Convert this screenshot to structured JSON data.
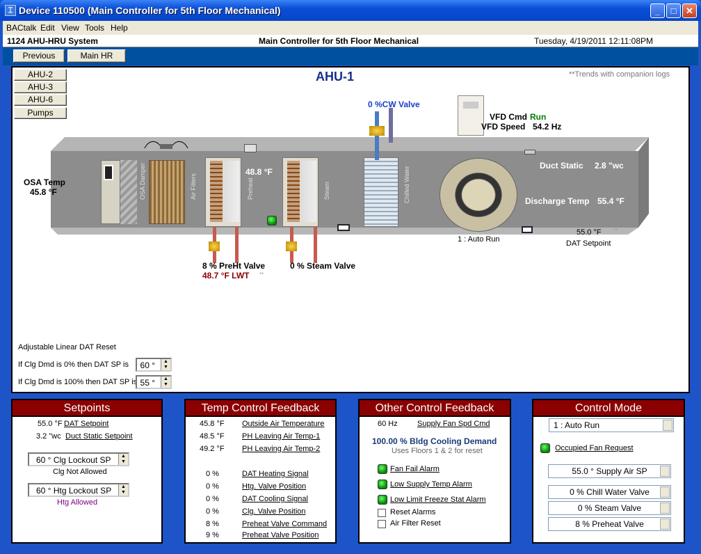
{
  "window": {
    "title": "Device 110500 (Main Controller for 5th Floor Mechanical)",
    "icon": "bactalk-icon"
  },
  "menu": [
    "BACtalk",
    "Edit",
    "View",
    "Tools",
    "Help"
  ],
  "header": {
    "system": "1124 AHU-HRU System",
    "controller": "Main Controller for 5th Floor Mechanical",
    "datetime": "Tuesday, 4/19/2011 12:11:08PM"
  },
  "nav": {
    "previous": "Previous",
    "main": "Main HR"
  },
  "side_buttons": [
    "AHU-2",
    "AHU-3",
    "AHU-6",
    "Pumps"
  ],
  "diagram": {
    "title": "AHU-1",
    "trends_note": "**Trends with companion logs",
    "osa_label": "OSA Temp",
    "osa_value": "45.8 °F",
    "osa_damper": "OSA Damper",
    "air_filters": "Air Filters",
    "preheat": "Preheat",
    "steam": "Steam",
    "chilled_water": "Chilled Water",
    "preheat_leaving": "48.8 °F",
    "cw_valve": "0 %CW Valve",
    "vfd_cmd_label": "VFD Cmd",
    "vfd_cmd_value": "Run",
    "vfd_speed_label": "VFD Speed",
    "vfd_speed_value": "54.2 Hz",
    "duct_static_label": "Duct Static",
    "duct_static_value": "2.8 \"wc",
    "discharge_label": "Discharge Temp",
    "discharge_value": "55.4 °F",
    "preht_valve": "8 % PreHt Valve",
    "preht_lwt": "48.7 °F LWT",
    "lwt_mark": "**",
    "steam_valve": "0 % Steam Valve",
    "auto_run": "1 : Auto Run",
    "dat_sp_value": "55.0 °F",
    "dat_sp_mark": "**",
    "dat_sp_label": "DAT Setpoint"
  },
  "reset": {
    "title": "Adjustable Linear DAT Reset",
    "row1_label": "If Clg Dmd is 0% then DAT SP is",
    "row1_value": "60 °",
    "row2_label": "If Clg Dmd is 100% then DAT SP is",
    "row2_value": "55 °"
  },
  "setpoints": {
    "title": "Setpoints",
    "dat_value": "55.0 °F",
    "dat_label": "DAT Setpoint",
    "static_value": "3.2 \"wc",
    "static_label": "Duct Static Setpoint",
    "clg_lockout": "60 ° Clg Lockout SP",
    "clg_status": "Clg Not Allowed",
    "htg_lockout": "60 ° Htg Lockout SP",
    "htg_status": "Htg Allowed"
  },
  "temp_feedback": {
    "title": "Temp Control Feedback",
    "rows": [
      {
        "value": "45.8 °F",
        "label": "Outside Air Temperature"
      },
      {
        "value": "48.5 °F",
        "label": "PH Leaving Air Temp-1"
      },
      {
        "value": "49.2 °F",
        "label": "PH Leaving Air Temp-2"
      },
      {
        "value": "0 %",
        "label": "DAT Heating Signal"
      },
      {
        "value": "0 %",
        "label": "Htg. Valve Position"
      },
      {
        "value": "0 %",
        "label": "DAT Cooling Signal"
      },
      {
        "value": "0 %",
        "label": "Clg. Valve Position"
      },
      {
        "value": "8 %",
        "label": "Preheat Valve Command"
      },
      {
        "value": "9 %",
        "label": "Preheat Valve Position"
      }
    ]
  },
  "other_feedback": {
    "title": "Other Control Feedback",
    "fan_value": "60 Hz",
    "fan_label": "Supply Fan Spd Cmd",
    "demand": "100.00 % Bldg Cooling Demand",
    "demand_note": "Uses Floors 1 & 2 for reset",
    "alarms": [
      "Fan Fail Alarm",
      "Low Supply Temp Alarm",
      "Low Limit Freeze Stat Alarm"
    ],
    "checks": [
      "Reset Alarms",
      "Air Filter Reset"
    ]
  },
  "control_mode": {
    "title": "Control Mode",
    "mode": "1 : Auto Run",
    "occupied": "Occupied Fan Request",
    "items": [
      "55.0 ° Supply Air SP",
      "0 % Chill Water Valve",
      "0 % Steam Valve",
      "8 % Preheat Valve"
    ]
  },
  "colors": {
    "title_blue": "#1a2d8b",
    "panel_red": "#8b0000",
    "run_green": "#008000",
    "lwt_red": "#8b0000"
  }
}
